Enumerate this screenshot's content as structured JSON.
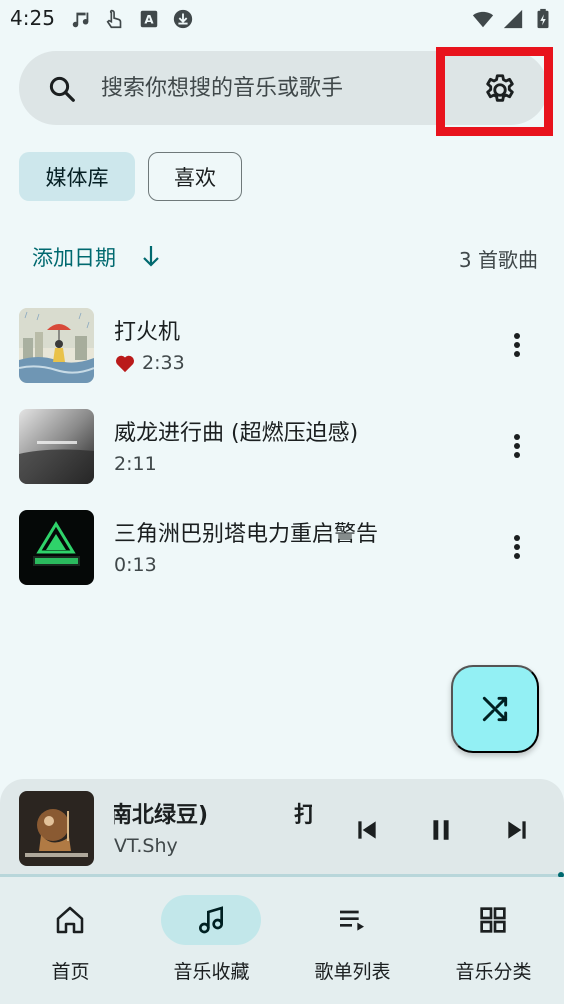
{
  "status_bar": {
    "time": "4:25",
    "left_icons": [
      "music-note-icon",
      "touch-icon",
      "a-badge-icon",
      "download-icon"
    ],
    "right_icons": [
      "wifi-icon",
      "signal-icon",
      "battery-icon"
    ]
  },
  "search": {
    "placeholder": "搜索你想搜的音乐或歌手",
    "settings_icon": "gear-icon"
  },
  "chips": {
    "library": "媒体库",
    "favorites": "喜欢"
  },
  "sort": {
    "label": "添加日期",
    "count": "3 首歌曲"
  },
  "songs": [
    {
      "title": "打火机",
      "duration": "2:33",
      "favorited": true
    },
    {
      "title": "威龙进行曲 (超燃压迫感)",
      "duration": "2:11",
      "favorited": false
    },
    {
      "title": "三角洲巴别塔电力重启警告",
      "duration": "0:13",
      "favorited": false
    }
  ],
  "now_playing": {
    "title": "南北绿豆)",
    "title_next": "打",
    "artist": "VT.Shy"
  },
  "nav": [
    {
      "label": "首页",
      "icon": "home-icon",
      "active": false
    },
    {
      "label": "音乐收藏",
      "icon": "music-notes-icon",
      "active": true
    },
    {
      "label": "歌单列表",
      "icon": "playlist-icon",
      "active": false
    },
    {
      "label": "音乐分类",
      "icon": "grid-icon",
      "active": false
    }
  ],
  "colors": {
    "accent": "#00696f",
    "highlight": "#e8131d",
    "fab": "#93f0f4",
    "heart": "#ba1a1a"
  }
}
